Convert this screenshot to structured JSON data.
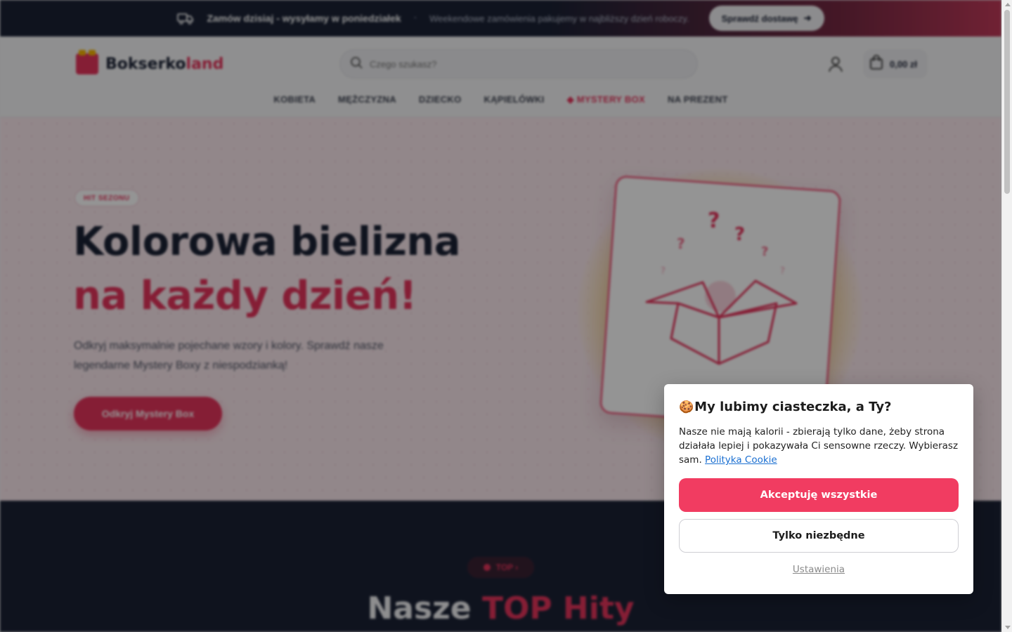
{
  "topbar": {
    "headline": "Zamów dzisiaj - wysyłamy w poniedziałek",
    "separator": "·",
    "note": "Weekendowe zamówienia pakujemy w najbliższy dzień roboczy.",
    "button_label": "Sprawdź dostawę"
  },
  "header": {
    "logo_main": "Bokserko",
    "logo_accent": "land",
    "search_placeholder": "Czego szukasz?",
    "cart_total": "0,00 zł"
  },
  "nav": {
    "items": [
      {
        "label": "KOBIETA"
      },
      {
        "label": "MĘŻCZYZNA"
      },
      {
        "label": "DZIECKO"
      },
      {
        "label": "KĄPIELÓWKI"
      },
      {
        "label": "◆ MYSTERY BOX"
      },
      {
        "label": "NA PREZENT"
      }
    ]
  },
  "hero": {
    "badge": "HIT SEZONU",
    "title_line1": "Kolorowa bielizna",
    "title_line2": "na każdy dzień!",
    "lead": "Odkryj maksymalnie pojechane wzory i kolory. Sprawdź nasze legendarne Mystery Boxy z niespodzianką!",
    "cta": "Odkryj Mystery Box"
  },
  "top_section": {
    "pill": "TOP ›",
    "title_part1": "Nasze ",
    "title_part2": "TOP Hity"
  },
  "cookie": {
    "emoji": "🍪",
    "title": "My lubimy ciasteczka, a Ty?",
    "text": "Nasze nie mają kalorii - zbierają tylko dane, żeby strona działała lepiej i pokazywała Ci sensowne rzeczy. Wybierasz sam. ",
    "policy_link": "Polityka Cookie",
    "accept_label": "Akceptuję wszystkie",
    "necessary_label": "Tylko niezbędne",
    "settings_label": "Ustawienia"
  },
  "colors": {
    "accent": "#e6345c",
    "dark": "#1b2235",
    "accept_button": "#f13c61"
  }
}
